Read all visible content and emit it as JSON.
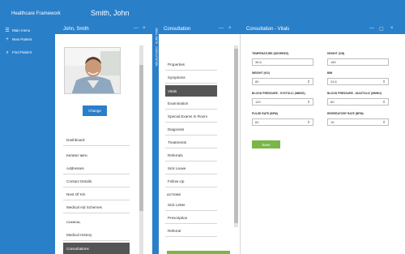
{
  "app": {
    "title": "Healthcare Framework",
    "patient_name": "Smith, John"
  },
  "nav": [
    {
      "icon": "menu-icon",
      "glyph": "☰",
      "label": "Main menu"
    },
    {
      "icon": "plus-icon",
      "glyph": "+",
      "label": "New Patient"
    },
    {
      "icon": "search-icon",
      "glyph": "⌕",
      "label": "Find Patient"
    }
  ],
  "panels": {
    "patient": {
      "title": "John, Smith",
      "minimize": "—",
      "close": "×"
    },
    "consultation": {
      "title": "Consultation",
      "minimize": "—",
      "close": "×"
    },
    "vitals": {
      "title": "Consultation - Vitals",
      "minimize": "—",
      "restore": "▢",
      "close": "×"
    }
  },
  "vertical_tab": "JOHN, SMITH - CONSULTATION",
  "patient": {
    "change_button": "Change",
    "dashboard": "Dashboard",
    "section_patient_info": "PATIENT INFO",
    "patient_items": [
      "Addresses",
      "Contact Details",
      "Next Of Kin",
      "Medical Aid Schemes"
    ],
    "section_clinical": "CLINICAL",
    "clinical_items": [
      "Medical History",
      "Consultations"
    ],
    "active_item": "Consultations"
  },
  "consultation": {
    "items": [
      "Properties",
      "Symptoms",
      "Vitals",
      "Examination",
      "Special Exams In Room",
      "Diagnosis",
      "Treatments",
      "Referrals",
      "Sick Leave",
      "Follow Up"
    ],
    "active_item": "Vitals",
    "section_actions": "ACTIONS",
    "actions": [
      "Sick Letter",
      "Prescription",
      "Referral"
    ]
  },
  "vitals": {
    "fields": [
      {
        "label": "TEMPERATURE (DEGREES)",
        "value": "36.6"
      },
      {
        "label": "HEIGHT (CM)",
        "value": "180"
      },
      {
        "label": "WEIGHT (KG)",
        "value": "80"
      },
      {
        "label": "BMI",
        "value": "24.6"
      },
      {
        "label": "BLOOD PRESSURE - SYSTOLIC (MMHG)",
        "value": "120"
      },
      {
        "label": "BLOOD PRESSURE - DIASTOLIC (MMHG)",
        "value": "80"
      },
      {
        "label": "PULSE RATE (BPM)",
        "value": "60"
      },
      {
        "label": "RESPIRATORY RATE (BPM)",
        "value": "16"
      }
    ],
    "save_button": "Save",
    "spin_glyph": "⇕"
  },
  "colors": {
    "accent": "#2a7fc9",
    "active_row": "#555555",
    "save": "#7ab648"
  }
}
